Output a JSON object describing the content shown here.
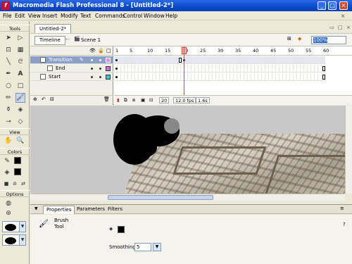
{
  "window": {
    "title": "Macromedia Flash Professional 8 - [Untitled-2*]",
    "app_icon": "flash-logo-icon",
    "controls": [
      "minimize-icon",
      "maximize-icon",
      "close-icon"
    ]
  },
  "menu": [
    "File",
    "Edit",
    "View",
    "Insert",
    "Modify",
    "Text",
    "Commands",
    "Control",
    "Window",
    "Help"
  ],
  "tools": {
    "header": "Tools",
    "view_header": "View",
    "colors_header": "Colors",
    "options_header": "Options",
    "selected_tool": "brush-tool"
  },
  "document": {
    "tab": "Untitled-2*",
    "timeline_button": "Timeline",
    "scene": "Scene 1",
    "zoom": "100%"
  },
  "timeline": {
    "layers": [
      {
        "name": "Transition",
        "selected": true
      },
      {
        "name": "End",
        "selected": false
      },
      {
        "name": "Start",
        "selected": false
      }
    ],
    "ruler": [
      "1",
      "5",
      "10",
      "15",
      "20",
      "25",
      "30",
      "35",
      "40",
      "45",
      "50",
      "55",
      "60"
    ],
    "current_frame": "20",
    "fps": "12.0 fps",
    "elapsed": "1.6s"
  },
  "properties": {
    "tabs": [
      "Properties",
      "Parameters",
      "Filters"
    ],
    "tool_name_line1": "Brush",
    "tool_name_line2": "Tool",
    "smoothing_label": "Smoothing",
    "smoothing_value": "5"
  },
  "colors": {
    "title_bar": "#0a48c8",
    "stage_bg": "#c8c8c8",
    "playhead": "#dd4433",
    "stroke": "#000000",
    "fill": "#000000"
  }
}
